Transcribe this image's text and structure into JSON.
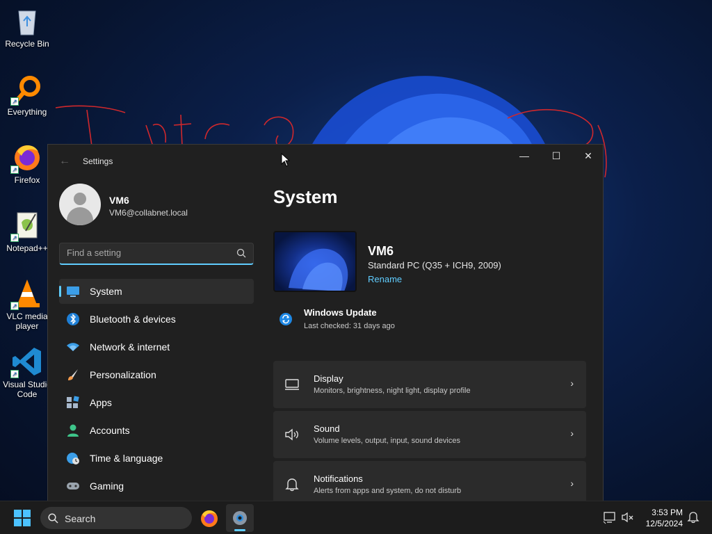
{
  "desktop": {
    "icons": [
      {
        "label": "Recycle Bin"
      },
      {
        "label": "Everything"
      },
      {
        "label": "Firefox"
      },
      {
        "label": "Notepad++"
      },
      {
        "label": "VLC media player"
      },
      {
        "label": "Visual Studio Code"
      }
    ]
  },
  "window": {
    "title": "Settings",
    "controls": {
      "minimize": "—",
      "maximize": "☐",
      "close": "✕"
    }
  },
  "profile": {
    "name": "VM6",
    "email": "VM6@collabnet.local"
  },
  "search": {
    "placeholder": "Find a setting",
    "value": ""
  },
  "nav": {
    "items": [
      {
        "label": "System",
        "icon": "system-icon",
        "active": true
      },
      {
        "label": "Bluetooth & devices",
        "icon": "bluetooth-icon"
      },
      {
        "label": "Network & internet",
        "icon": "wifi-icon"
      },
      {
        "label": "Personalization",
        "icon": "brush-icon"
      },
      {
        "label": "Apps",
        "icon": "apps-icon"
      },
      {
        "label": "Accounts",
        "icon": "accounts-icon"
      },
      {
        "label": "Time & language",
        "icon": "globe-clock-icon"
      },
      {
        "label": "Gaming",
        "icon": "controller-icon"
      }
    ]
  },
  "main": {
    "title": "System",
    "device": {
      "name": "VM6",
      "model": "Standard PC (Q35 + ICH9, 2009)",
      "rename_label": "Rename"
    },
    "update": {
      "title": "Windows Update",
      "subtitle": "Last checked: 31 days ago"
    },
    "cards": [
      {
        "title": "Display",
        "subtitle": "Monitors, brightness, night light, display profile",
        "icon": "monitor-icon"
      },
      {
        "title": "Sound",
        "subtitle": "Volume levels, output, input, sound devices",
        "icon": "speaker-icon"
      },
      {
        "title": "Notifications",
        "subtitle": "Alerts from apps and system, do not disturb",
        "icon": "bell-icon"
      }
    ]
  },
  "taskbar": {
    "search_label": "Search",
    "time": "3:53 PM",
    "date": "12/5/2024"
  },
  "colors": {
    "accent": "#60cdff",
    "window_bg": "#202020",
    "card_bg": "#2b2b2b"
  }
}
